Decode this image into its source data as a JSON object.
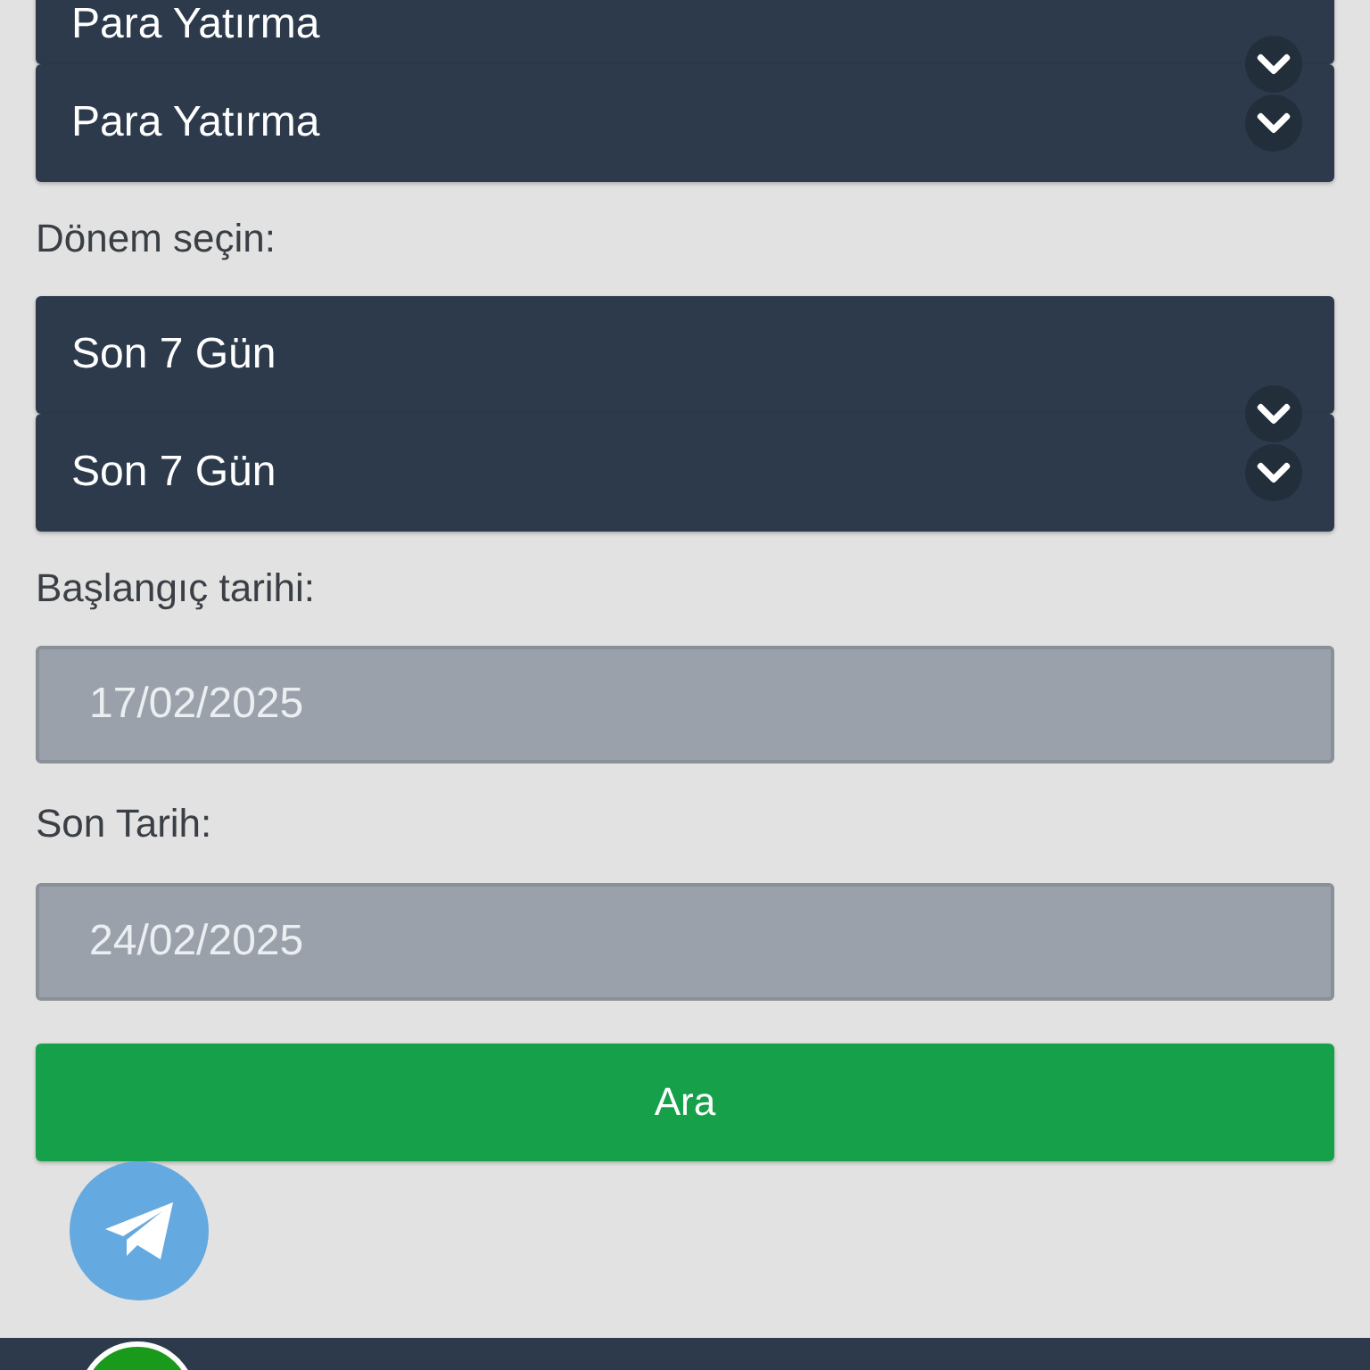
{
  "transaction_type": {
    "rows": [
      "Para Yatırma",
      "Para Yatırma"
    ]
  },
  "period": {
    "label": "Dönem seçin:",
    "rows": [
      "Son 7 Gün",
      "Son 7 Gün"
    ]
  },
  "start_date": {
    "label": "Başlangıç tarihi:",
    "value": "17/02/2025"
  },
  "end_date": {
    "label": "Son Tarih:",
    "value": "24/02/2025"
  },
  "search_button": "Ara"
}
